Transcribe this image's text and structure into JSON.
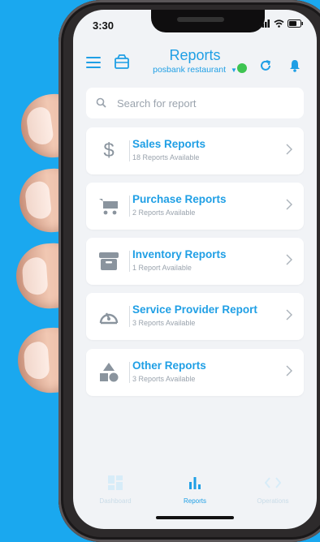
{
  "status": {
    "time": "3:30"
  },
  "header": {
    "title": "Reports",
    "subtitle": "posbank restaurant",
    "online_color": "#3ec451"
  },
  "search": {
    "placeholder": "Search for report"
  },
  "reports": [
    {
      "title": "Sales Reports",
      "subtitle": "18 Reports Available",
      "icon": "dollar-icon"
    },
    {
      "title": "Purchase Reports",
      "subtitle": "2 Reports Available",
      "icon": "cart-icon"
    },
    {
      "title": "Inventory Reports",
      "subtitle": "1 Report Available",
      "icon": "archive-box-icon"
    },
    {
      "title": "Service Provider Report",
      "subtitle": "3 Reports Available",
      "icon": "gauge-icon"
    },
    {
      "title": "Other Reports",
      "subtitle": "3 Reports Available",
      "icon": "shapes-icon"
    }
  ],
  "tabs": [
    {
      "label": "Dashboard",
      "icon": "grid-icon"
    },
    {
      "label": "Reports",
      "icon": "bar-chart-icon"
    },
    {
      "label": "Operations",
      "icon": "code-icon"
    }
  ],
  "colors": {
    "accent": "#1f9fe5",
    "background": "#1aa8ef",
    "muted": "#9aa3ad"
  }
}
